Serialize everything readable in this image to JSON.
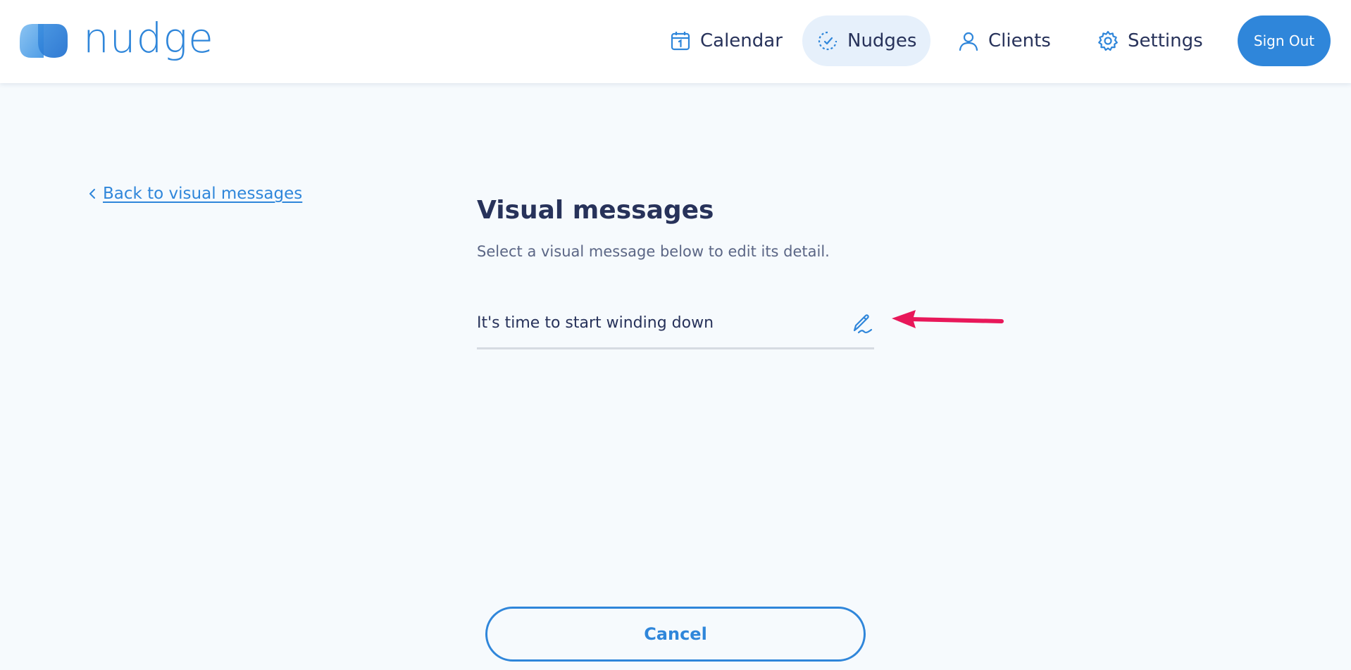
{
  "app": {
    "logo_text": "nudge",
    "accent_color": "#2f86da",
    "text_color": "#27325a"
  },
  "nav": {
    "items": [
      {
        "label": "Calendar",
        "icon": "calendar-icon"
      },
      {
        "label": "Nudges",
        "icon": "nudges-icon",
        "active": true
      },
      {
        "label": "Clients",
        "icon": "user-icon"
      },
      {
        "label": "Settings",
        "icon": "gear-icon"
      }
    ],
    "sign_out_label": "Sign Out"
  },
  "back_link": {
    "label": "Back to visual messages",
    "icon": "chevron-left-icon"
  },
  "page": {
    "title": "Visual messages",
    "subtitle": "Select a visual message below to edit its detail."
  },
  "messages": [
    {
      "text": "It's time to start winding down",
      "icon": "pen-icon"
    }
  ],
  "annotation": {
    "icon": "arrow-left-icon",
    "color": "#e8185a"
  },
  "footer": {
    "cancel_label": "Cancel"
  }
}
